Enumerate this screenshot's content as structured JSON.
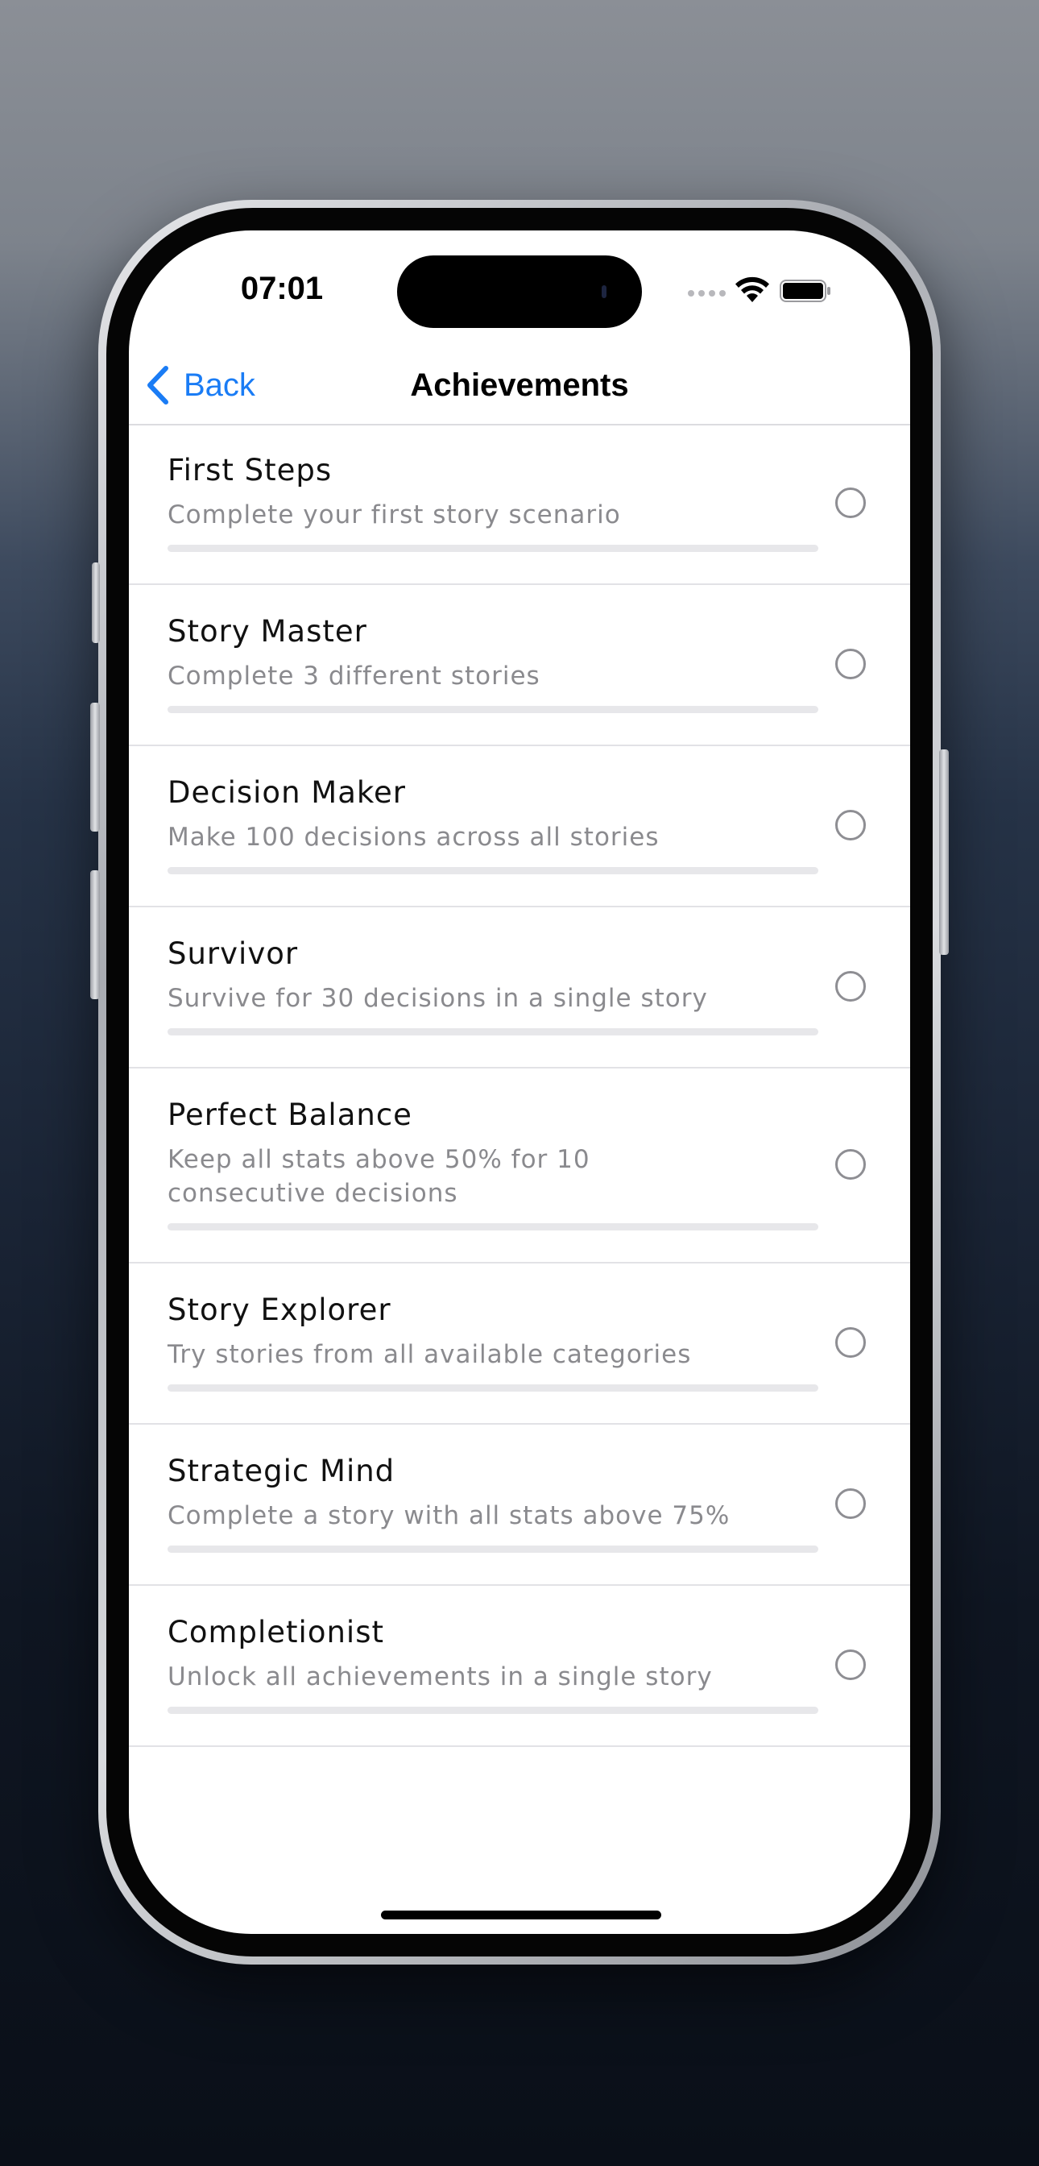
{
  "status_bar": {
    "time": "07:01",
    "signal_icon": "cellular-signal-dots",
    "wifi_icon": "wifi-icon",
    "battery_icon": "battery-icon"
  },
  "nav": {
    "back_label": "Back",
    "back_icon": "chevron-left-icon",
    "title": "Achievements"
  },
  "colors": {
    "accent": "#1a7cf5",
    "title_text": "#111111",
    "secondary_text": "#8a8a8e",
    "progress_track": "#e7e7ea"
  },
  "achievements": [
    {
      "title": "First Steps",
      "description": "Complete your first story scenario",
      "progress": 0,
      "unlocked": false
    },
    {
      "title": "Story Master",
      "description": "Complete 3 different stories",
      "progress": 0,
      "unlocked": false
    },
    {
      "title": "Decision Maker",
      "description": "Make 100 decisions across all stories",
      "progress": 0,
      "unlocked": false
    },
    {
      "title": "Survivor",
      "description": "Survive for 30 decisions in a single story",
      "progress": 0,
      "unlocked": false
    },
    {
      "title": "Perfect Balance",
      "description": "Keep all stats above 50% for 10 consecutive decisions",
      "progress": 0,
      "unlocked": false
    },
    {
      "title": "Story Explorer",
      "description": "Try stories from all available categories",
      "progress": 0,
      "unlocked": false
    },
    {
      "title": "Strategic Mind",
      "description": "Complete a story with all stats above 75%",
      "progress": 0,
      "unlocked": false
    },
    {
      "title": "Completionist",
      "description": "Unlock all achievements in a single story",
      "progress": 0,
      "unlocked": false
    }
  ]
}
